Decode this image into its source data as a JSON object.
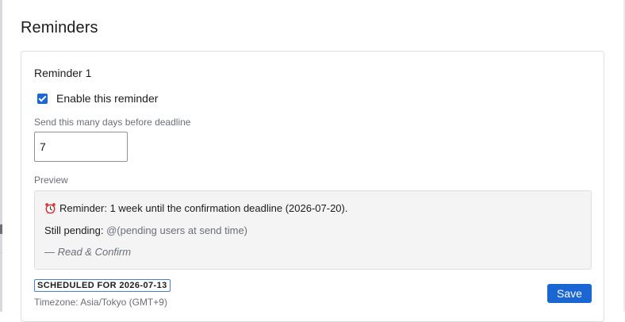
{
  "dialog": {
    "title": "Reminders"
  },
  "reminder": {
    "title": "Reminder 1",
    "enable_label": "Enable this reminder",
    "enabled": true,
    "days_label": "Send this many days before deadline",
    "days_value": "7",
    "preview_label": "Preview",
    "preview": {
      "icon": "alarm-clock-icon",
      "line1": "Reminder: 1 week until the confirmation deadline (2026-07-20).",
      "line2_prefix": "Still pending: ",
      "line2_mention": "@(pending users at send time)",
      "signature": "— Read & Confirm"
    },
    "scheduled_badge": "SCHEDULED FOR 2026-07-13",
    "timezone": "Timezone: Asia/Tokyo (GMT+9)",
    "save_label": "Save"
  },
  "colors": {
    "accent": "#1a66d2",
    "muted_text": "#6b6f78",
    "preview_bg": "#f4f4f5"
  }
}
